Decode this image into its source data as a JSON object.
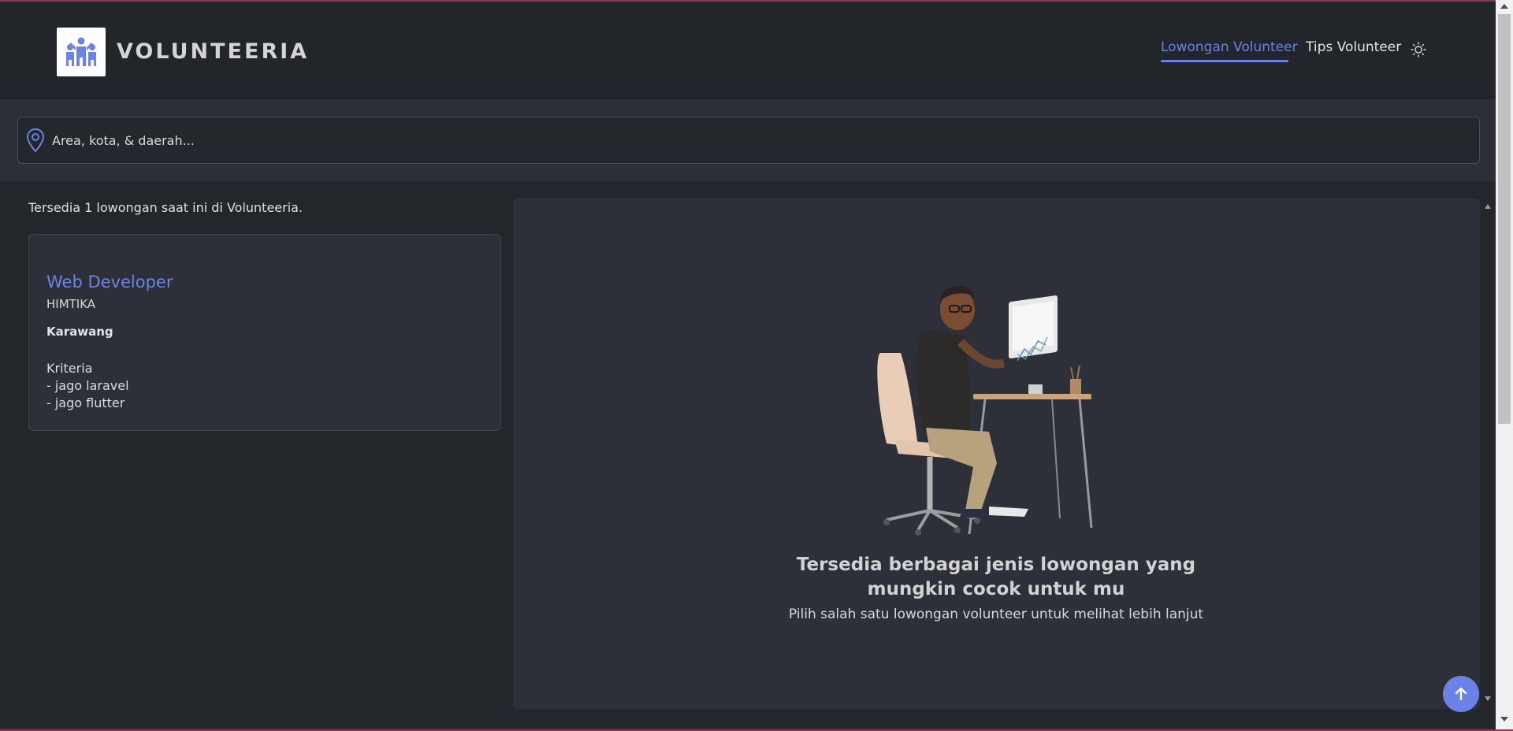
{
  "app": {
    "brand_name": "VOLUNTEERIA",
    "accent_color": "#6b82e6"
  },
  "nav": {
    "items": [
      {
        "label": "Lowongan Volunteer",
        "active": true
      },
      {
        "label": "Tips Volunteer",
        "active": false
      }
    ],
    "theme_toggle_icon": "sun-icon"
  },
  "search": {
    "placeholder": "Area, kota, & daerah...",
    "value": "",
    "icon": "location-pin-icon"
  },
  "listing": {
    "count_text": "Tersedia 1 lowongan saat ini di Volunteeria.",
    "jobs": [
      {
        "title": "Web Developer",
        "organization": "HIMTIKA",
        "location": "Karawang",
        "criteria_heading": "Kriteria",
        "criteria": [
          "- jago laravel",
          "- jago flutter"
        ]
      }
    ]
  },
  "detail": {
    "illustration": "person-at-desk-illustration",
    "title": "Tersedia berbagai jenis lowongan yang mungkin cocok untuk mu",
    "subtitle": "Pilih salah satu lowongan volunteer untuk melihat lebih lanjut"
  },
  "back_to_top_icon": "arrow-up-icon"
}
